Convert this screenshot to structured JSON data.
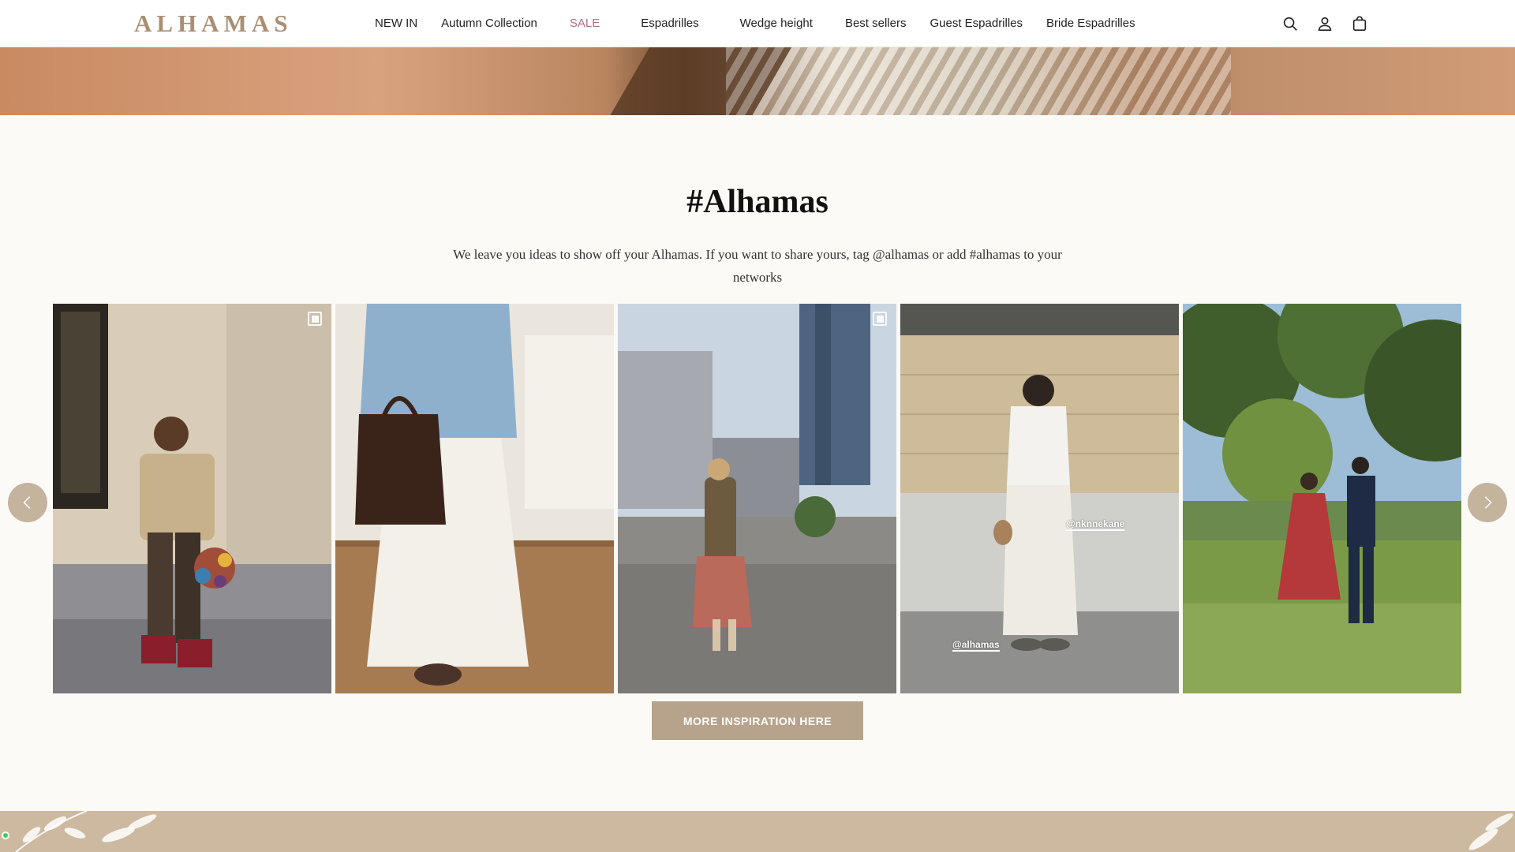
{
  "header": {
    "logo": "ALHAMAS",
    "nav": [
      {
        "label": "NEW IN"
      },
      {
        "label": "Autumn Collection"
      },
      {
        "label": "SALE"
      },
      {
        "label": "Espadrilles"
      },
      {
        "label": "Wedge height"
      },
      {
        "label": "Best sellers"
      },
      {
        "label": "Guest Espadrilles"
      },
      {
        "label": "Bride Espadrilles"
      }
    ],
    "icons": [
      "search-icon",
      "account-icon",
      "cart-icon"
    ]
  },
  "section": {
    "title": "#Alhamas",
    "description": "We leave you ideas to show off your Alhamas. If you want to share yours, tag @alhamas or add #alhamas to your networks",
    "cta_label": "MORE INSPIRATION HERE"
  },
  "gallery": {
    "tiles": [
      {
        "alt": "woman in trench coat with pompom bag and red wedges",
        "tag": ""
      },
      {
        "alt": "denim jacket with dark woven tote bag",
        "tag": ""
      },
      {
        "alt": "woman walking on city street with skyscrapers",
        "tag": ""
      },
      {
        "alt": "woman in white outfit against stone wall",
        "tag_top": "@nknnekane",
        "tag_bottom": "@alhamas"
      },
      {
        "alt": "couple dancing in a park",
        "tag": ""
      }
    ],
    "prev_icon": "chevron-left-icon",
    "next_icon": "chevron-right-icon"
  },
  "colors": {
    "accent": "#b7a38c",
    "logo": "#a98f72",
    "sale": "#b06d86",
    "background": "#fcfaf6",
    "footer": "#cdb9a0"
  }
}
